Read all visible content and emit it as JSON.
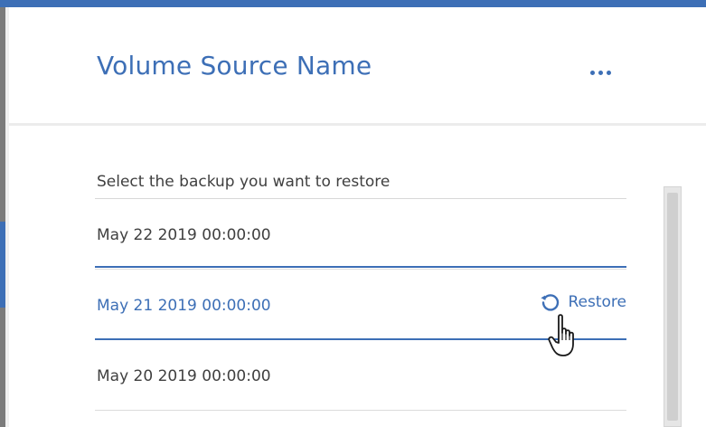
{
  "panel": {
    "title": "Volume Source Name",
    "menu_icon": "more-horizontal-icon"
  },
  "backup_list": {
    "label": "Select the backup you want to restore",
    "rows": [
      {
        "date": "May 22 2019 00:00:00",
        "selected": false
      },
      {
        "date": "May 21 2019 00:00:00",
        "selected": true,
        "action_label": "Restore",
        "action_icon": "restore-icon"
      },
      {
        "date": "May 20 2019 00:00:00",
        "selected": false
      }
    ]
  },
  "cursor_icon": "pointer-hand-icon",
  "colors": {
    "accent": "#3d6fb6",
    "text": "#404040",
    "divider": "#dcdcdc",
    "background": "#ffffff"
  }
}
